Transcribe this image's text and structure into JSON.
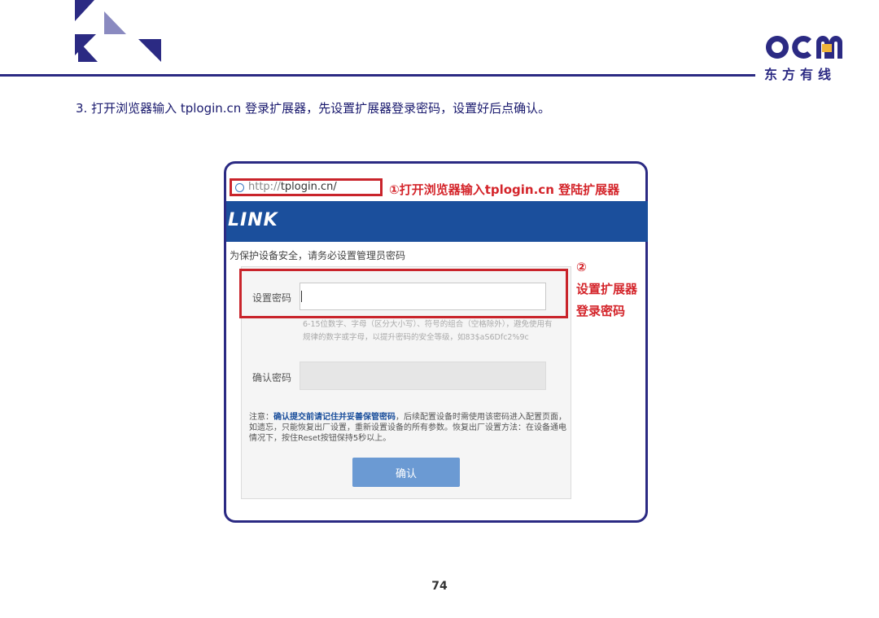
{
  "slide": {
    "instruction": "3. 打开浏览器输入 tplogin.cn 登录扩展器，先设置扩展器登录密码，设置好后点确认。",
    "page_number": "74"
  },
  "logo": {
    "brand": "OCM",
    "tagline": "东方有线"
  },
  "browser": {
    "address_prefix": "http://",
    "address_host": "tplogin.cn/"
  },
  "router_page": {
    "brand": "LINK",
    "notice": "为保护设备安全，请务必设置管理员密码",
    "password_label": "设置密码",
    "password_value": "",
    "hint": "6-15位数字、字母（区分大小写）、符号的组合（空格除外），避免使用有规律的数字或字母，以提升密码的安全等级，如83$aS6Dfc2%9c",
    "confirm_label": "确认密码",
    "note_prefix": "注意：",
    "note_highlight": "确认提交前请记住并妥善保管密码",
    "note_rest": "，后续配置设备时需使用该密码进入配置页面，如遗忘，只能恢复出厂设置，重新设置设备的所有参数。恢复出厂设置方法：在设备通电情况下，按住Reset按钮保持5秒以上。",
    "confirm_button": "确认"
  },
  "annotations": {
    "step1": "①打开浏览器输入tplogin.cn 登陆扩展器",
    "step2_num": "②",
    "step2_line1": "设置扩展器",
    "step2_line2": "登录密码"
  },
  "colors": {
    "brand_navy": "#2b2a83",
    "banner_blue": "#1b4f9c",
    "annotation_red": "#d4252b",
    "button_blue": "#6b9ad3"
  }
}
